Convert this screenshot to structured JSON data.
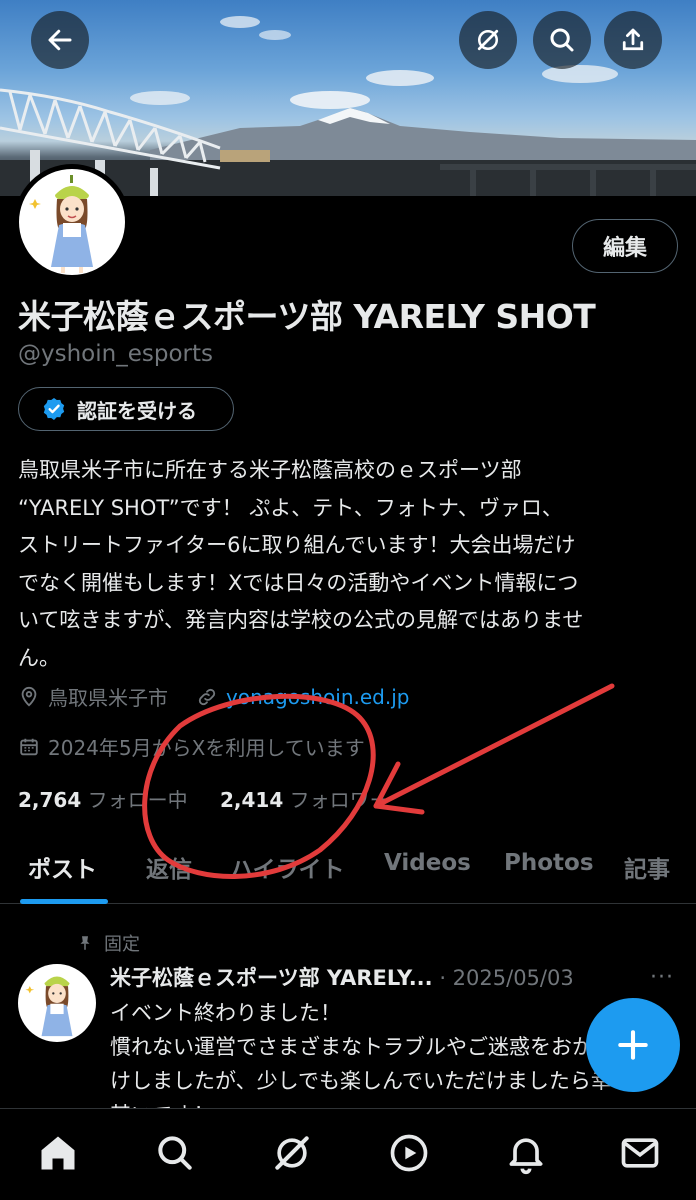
{
  "header": {
    "back_icon": "back-arrow-icon",
    "grok_icon": "grok-icon",
    "search_icon": "search-icon",
    "share_icon": "share-icon"
  },
  "profile": {
    "name": "米子松蔭ｅスポーツ部 YARELY SHOT",
    "handle": "@yshoin_esports",
    "edit_label": "編集",
    "verify_label": "認証を受ける",
    "bio_lines": [
      "鳥取県米子市に所在する米子松蔭高校のｅスポーツ部",
      "“YARELY SHOT”です！ ぷよ、テト、フォトナ、ヴァロ、",
      "ストリートファイター6に取り組んでいます！大会出場だけ",
      "でなく開催もします！Xでは日々の活動やイベント情報につ",
      "いて呟きますが、発言内容は学校の公式の見解ではありませ",
      "ん。"
    ],
    "location": "鳥取県米子市",
    "link": "yonagoshoin.ed.jp",
    "joined": "2024年5月からXを利用しています",
    "following_count": "2,764",
    "following_label": "フォロー中",
    "followers_count": "2,414",
    "followers_label": "フォロワー"
  },
  "tabs": [
    "ポスト",
    "返信",
    "ハイライト",
    "Videos",
    "Photos",
    "記事"
  ],
  "post": {
    "pinned_label": "固定",
    "author": "米子松蔭ｅスポーツ部 YARELY...",
    "date": "· 2025/05/03",
    "more": "···",
    "lines": [
      "イベント終わりました！",
      "慣れない運営でさまざまなトラブルやご迷惑をおか",
      "けしましたが、少しでも楽しんでいただけましたら幸",
      "甚いです！"
    ]
  },
  "nav": [
    "home-icon",
    "search-icon",
    "grok-icon",
    "video-icon",
    "notifications-icon",
    "messages-icon"
  ],
  "colors": {
    "accent": "#1d9bf0",
    "annotation": "#e23b3b",
    "background": "#000000",
    "muted": "#71767b"
  }
}
